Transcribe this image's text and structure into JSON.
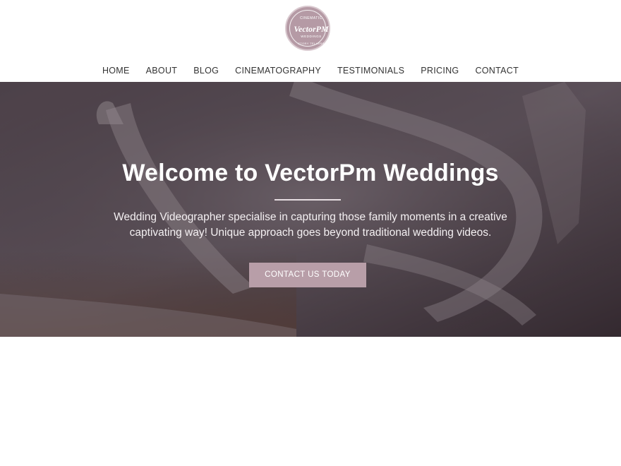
{
  "logo": {
    "top_text": "CINEMATIC",
    "brand": "VectorPM",
    "sub_text": "WEDDINGS",
    "bottom_text": "STORY TELLERS"
  },
  "nav": {
    "items": [
      {
        "label": "HOME"
      },
      {
        "label": "ABOUT"
      },
      {
        "label": "BLOG"
      },
      {
        "label": "CINEMATOGRAPHY"
      },
      {
        "label": "TESTIMONIALS"
      },
      {
        "label": "PRICING"
      },
      {
        "label": "CONTACT"
      }
    ]
  },
  "hero": {
    "title": "Welcome to VectorPm Weddings",
    "text": "Wedding Videographer specialise in capturing those family moments in a creative captivating way! Unique approach goes beyond traditional wedding videos.",
    "button_label": "CONTACT US TODAY",
    "image": "wedding-shoes-photo"
  },
  "colors": {
    "accent": "#b89ea8",
    "logo": "#b59aa5",
    "hero_overlay": "#2a2027"
  }
}
